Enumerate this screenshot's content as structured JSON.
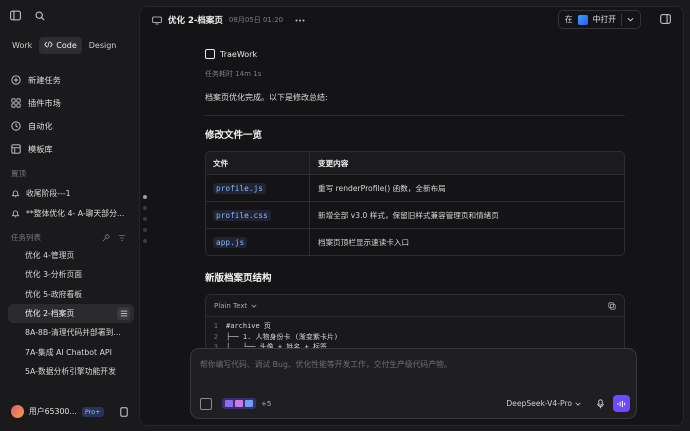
{
  "sidebar": {
    "modes": [
      {
        "label": "Work",
        "active": false
      },
      {
        "label": "Code",
        "active": true,
        "icon": "code-icon"
      },
      {
        "label": "Design",
        "active": false
      }
    ],
    "nav": [
      {
        "label": "新建任务",
        "icon": "add-task-icon"
      },
      {
        "label": "插件市场",
        "icon": "grid-icon"
      },
      {
        "label": "自动化",
        "icon": "clock-icon"
      },
      {
        "label": "模板库",
        "icon": "template-icon"
      }
    ],
    "pinned_label": "置顶",
    "pinned": [
      {
        "label": "收尾阶段---1",
        "icon": "bell-icon"
      },
      {
        "label": "**整体优化 4- A-聊天部分...",
        "icon": "bell-icon"
      }
    ],
    "tasks_label": "任务列表",
    "tasks": [
      {
        "label": "优化 4-管理页",
        "active": false
      },
      {
        "label": "优化 3-分析页面",
        "active": false
      },
      {
        "label": "优化 5-政府看板",
        "active": false
      },
      {
        "label": "优化 2-档案页",
        "active": true
      },
      {
        "label": "8A-8B-清理代码并部署到...",
        "active": false
      },
      {
        "label": "7A-集成 AI Chatbot API",
        "active": false
      },
      {
        "label": "5A-数据分析引擎功能开发",
        "active": false
      }
    ],
    "user": {
      "name": "用户65300...",
      "badge": "Pro+"
    }
  },
  "header": {
    "title": "优化 2-档案页",
    "time": "08月05日 01:20",
    "open_in_prefix": "在",
    "open_in_suffix": "中打开"
  },
  "message": {
    "brand": "TraeWork",
    "duration": "任务耗时 14m 1s",
    "intro": "档案页优化完成。以下是修改总结:",
    "section1_title": "修改文件一览",
    "table": {
      "headers": [
        "文件",
        "变更内容"
      ],
      "rows": [
        {
          "file": "profile.js",
          "change": "重写 renderProfile() 函数，全新布局"
        },
        {
          "file": "profile.css",
          "change": "新增全部 v3.0 样式，保留旧样式兼容管理页和情绪页"
        },
        {
          "file": "app.js",
          "change": "档案页顶栏显示速读卡入口"
        }
      ]
    },
    "section2_title": "新版档案页结构",
    "code": {
      "lang": "Plain Text",
      "lines": [
        {
          "n": "1",
          "text": "#archive 页"
        },
        {
          "n": "2",
          "text": "├── 1. 人物身份卡 (渐变紫卡片)"
        },
        {
          "n": "3",
          "text": "│   └── 头像 + 姓名 + 标签"
        }
      ]
    }
  },
  "composer": {
    "placeholder": "帮你编写代码、调试 Bug、优化性能等开发工作，交付生产级代码产物。",
    "more_count": "+5",
    "model": "DeepSeek-V4-Pro"
  },
  "colors": {
    "accent": "#6e49ff",
    "code_link": "#8fb6ff",
    "pro_badge": "#9db6ff"
  }
}
